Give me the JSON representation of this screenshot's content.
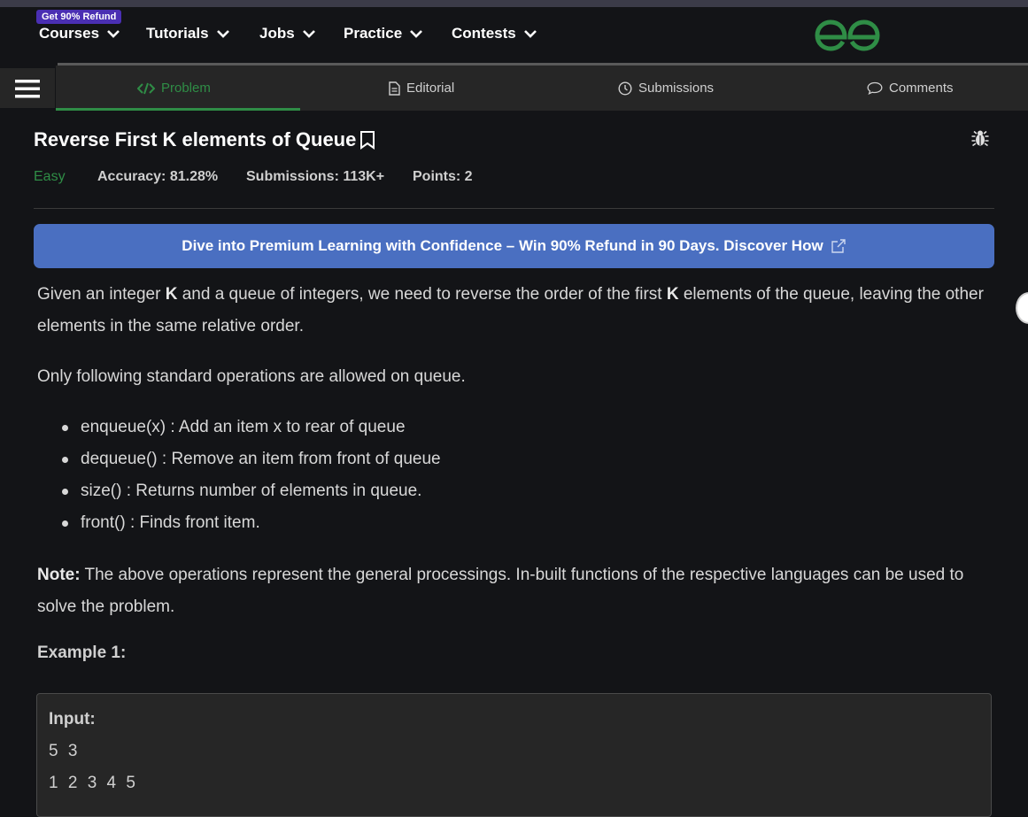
{
  "nav": {
    "badge": "Get 90% Refund",
    "items": [
      {
        "label": "Courses"
      },
      {
        "label": "Tutorials"
      },
      {
        "label": "Jobs"
      },
      {
        "label": "Practice"
      },
      {
        "label": "Contests"
      }
    ]
  },
  "tabs": {
    "problem": "Problem",
    "editorial": "Editorial",
    "submissions": "Submissions",
    "comments": "Comments"
  },
  "problem": {
    "title": "Reverse First K elements of Queue",
    "difficulty": "Easy",
    "accuracy": "Accuracy: 81.28%",
    "submissions": "Submissions: 113K+",
    "points": "Points: 2"
  },
  "banner": {
    "text": "Dive into Premium Learning with Confidence – Win 90% Refund in 90 Days. Discover How"
  },
  "statement": {
    "p1_a": "Given an integer ",
    "p1_k1": "K",
    "p1_b": " and a queue of integers, we need to reverse the order of the first ",
    "p1_k2": "K",
    "p1_c": " elements of the queue, leaving the other elements in the same relative order.",
    "p2": "Only following standard operations are allowed on queue.",
    "operations": [
      "enqueue(x) : Add an item x to rear of queue",
      "dequeue() : Remove an item from front of queue",
      "size() : Returns number of elements in queue.",
      "front() : Finds front item."
    ],
    "note_label": "Note:",
    "note_text": " The above operations represent the general processings. In-built functions of the respective languages can be used to solve the problem."
  },
  "example": {
    "title": "Example 1:",
    "input_label": "Input:",
    "input_line1": "5 3",
    "input_line2": "1 2 3 4 5"
  },
  "colors": {
    "accent_green": "#2f8d46",
    "banner_blue": "#4a6fc1",
    "badge_purple": "#4a2fb3"
  }
}
